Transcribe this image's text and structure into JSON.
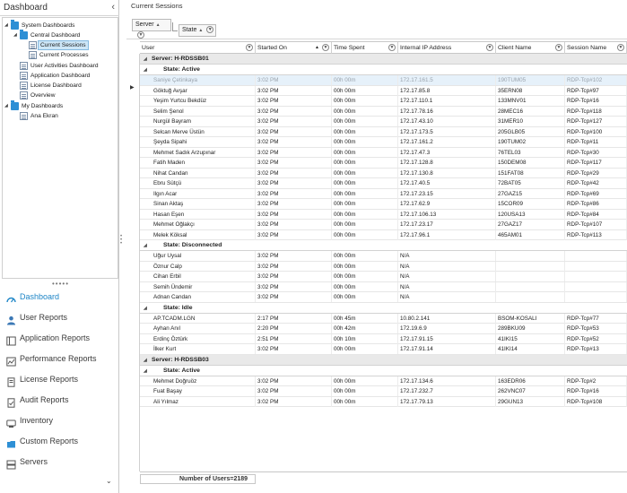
{
  "left": {
    "title": "Dashboard",
    "tree": [
      {
        "label": "System Dashboards",
        "icon": "folder-icon",
        "level": 0,
        "expanded": true
      },
      {
        "label": "Central Dashboard",
        "icon": "folder-icon",
        "level": 1,
        "expanded": true
      },
      {
        "label": "Current Sessions",
        "icon": "document-icon",
        "level": 2,
        "selected": true
      },
      {
        "label": "Current Processes",
        "icon": "document-icon",
        "level": 2
      },
      {
        "label": "User Activities Dashboard",
        "icon": "document-icon",
        "level": 1
      },
      {
        "label": "Application Dashboard",
        "icon": "document-icon",
        "level": 1
      },
      {
        "label": "License Dashboard",
        "icon": "document-icon",
        "level": 1
      },
      {
        "label": "Overview",
        "icon": "document-icon",
        "level": 1
      },
      {
        "label": "My Dashboards",
        "icon": "folder-icon",
        "level": 0,
        "expanded": true
      },
      {
        "label": "Ana Ekran",
        "icon": "document-icon",
        "level": 1
      }
    ],
    "nav": [
      {
        "label": "Dashboard",
        "icon": "dashboard-icon",
        "active": true
      },
      {
        "label": "User Reports",
        "icon": "user-icon"
      },
      {
        "label": "Application Reports",
        "icon": "application-icon"
      },
      {
        "label": "Performance Reports",
        "icon": "performance-icon"
      },
      {
        "label": "License Reports",
        "icon": "license-icon"
      },
      {
        "label": "Audit Reports",
        "icon": "audit-icon"
      },
      {
        "label": "Inventory",
        "icon": "inventory-icon"
      },
      {
        "label": "Custom Reports",
        "icon": "custom-reports-icon"
      },
      {
        "label": "Servers",
        "icon": "servers-icon"
      }
    ]
  },
  "main": {
    "title": "Current Sessions",
    "group_by": [
      "Server",
      "State"
    ],
    "columns": [
      "User",
      "Started On",
      "Time Spent",
      "Internal IP Address",
      "Client Name",
      "Session Name"
    ],
    "rows": [
      {
        "type": "server",
        "label": "Server: H-RDSSB01"
      },
      {
        "type": "state",
        "label": "State: Active"
      },
      {
        "type": "data",
        "dim": true,
        "current": true,
        "cells": [
          "Saniye Çetinkaya",
          "3:02 PM",
          "00h 00m",
          "172.17.161.5",
          "190TUM05",
          "RDP-Tcp#102"
        ]
      },
      {
        "type": "data",
        "cells": [
          "Göktuğ Avşar",
          "3:02 PM",
          "00h 00m",
          "172.17.85.8",
          "35ERN08",
          "RDP-Tcp#97"
        ]
      },
      {
        "type": "data",
        "cells": [
          "Yeşim Yurtcu Bekdüz",
          "3:02 PM",
          "00h 00m",
          "172.17.110.1",
          "133MNV01",
          "RDP-Tcp#16"
        ]
      },
      {
        "type": "data",
        "cells": [
          "Selim Şenol",
          "3:02 PM",
          "00h 00m",
          "172.17.78.16",
          "28MEC16",
          "RDP-Tcp#118"
        ]
      },
      {
        "type": "data",
        "cells": [
          "Nurgül Bayram",
          "3:02 PM",
          "00h 00m",
          "172.17.43.10",
          "31MER10",
          "RDP-Tcp#127"
        ]
      },
      {
        "type": "data",
        "cells": [
          "Selcan Merve Üstün",
          "3:02 PM",
          "00h 00m",
          "172.17.173.5",
          "205GLB05",
          "RDP-Tcp#100"
        ]
      },
      {
        "type": "data",
        "cells": [
          "Şeyda Sipahi",
          "3:02 PM",
          "00h 00m",
          "172.17.161.2",
          "190TUM02",
          "RDP-Tcp#11"
        ]
      },
      {
        "type": "data",
        "cells": [
          "Mehmet Sadık Arzupınar",
          "3:02 PM",
          "00h 00m",
          "172.17.47.3",
          "76TEL03",
          "RDP-Tcp#30"
        ]
      },
      {
        "type": "data",
        "cells": [
          "Fatih Maden",
          "3:02 PM",
          "00h 00m",
          "172.17.128.8",
          "150DEM08",
          "RDP-Tcp#117"
        ]
      },
      {
        "type": "data",
        "cells": [
          "Nihat Candan",
          "3:02 PM",
          "00h 00m",
          "172.17.130.8",
          "151FAT08",
          "RDP-Tcp#29"
        ]
      },
      {
        "type": "data",
        "cells": [
          "Ebru Sütçü",
          "3:02 PM",
          "00h 00m",
          "172.17.40.5",
          "72BAT05",
          "RDP-Tcp#42"
        ]
      },
      {
        "type": "data",
        "cells": [
          "Ilgın Acar",
          "3:02 PM",
          "00h 00m",
          "172.17.23.15",
          "27GAZ15",
          "RDP-Tcp#69"
        ]
      },
      {
        "type": "data",
        "cells": [
          "Sinan Aktaş",
          "3:02 PM",
          "00h 00m",
          "172.17.62.9",
          "15COR09",
          "RDP-Tcp#86"
        ]
      },
      {
        "type": "data",
        "cells": [
          "Hasan Eşen",
          "3:02 PM",
          "00h 00m",
          "172.17.106.13",
          "120USA13",
          "RDP-Tcp#84"
        ]
      },
      {
        "type": "data",
        "cells": [
          "Mehmet Oğlakçı",
          "3:02 PM",
          "00h 00m",
          "172.17.23.17",
          "27GAZ17",
          "RDP-Tcp#107"
        ]
      },
      {
        "type": "data",
        "cells": [
          "Melek Köksal",
          "3:02 PM",
          "00h 00m",
          "172.17.96.1",
          "465AM01",
          "RDP-Tcp#113"
        ]
      },
      {
        "type": "state",
        "label": "State: Disconnected"
      },
      {
        "type": "data",
        "cells": [
          "Uğur Uysal",
          "3:02 PM",
          "00h 00m",
          "N/A",
          "",
          ""
        ]
      },
      {
        "type": "data",
        "cells": [
          "Öznur Calp",
          "3:02 PM",
          "00h 00m",
          "N/A",
          "",
          ""
        ]
      },
      {
        "type": "data",
        "cells": [
          "Cihan Erbil",
          "3:02 PM",
          "00h 00m",
          "N/A",
          "",
          ""
        ]
      },
      {
        "type": "data",
        "cells": [
          "Semih Ündemir",
          "3:02 PM",
          "00h 00m",
          "N/A",
          "",
          ""
        ]
      },
      {
        "type": "data",
        "cells": [
          "Adnan Candan",
          "3:02 PM",
          "00h 00m",
          "N/A",
          "",
          ""
        ]
      },
      {
        "type": "state",
        "label": "State: Idle"
      },
      {
        "type": "data",
        "cells": [
          "AP.TCADM.LGN",
          "2:17 PM",
          "00h 45m",
          "10.80.2.141",
          "BSOM-KOSALI",
          "RDP-Tcp#77"
        ]
      },
      {
        "type": "data",
        "cells": [
          "Ayhan Anıl",
          "2:20 PM",
          "00h 42m",
          "172.19.6.9",
          "289BKU09",
          "RDP-Tcp#53"
        ]
      },
      {
        "type": "data",
        "cells": [
          "Erdinç Öztürk",
          "2:51 PM",
          "00h 10m",
          "172.17.91.15",
          "41IKI15",
          "RDP-Tcp#52"
        ]
      },
      {
        "type": "data",
        "cells": [
          "İlker Kurt",
          "3:02 PM",
          "00h 00m",
          "172.17.91.14",
          "41IKI14",
          "RDP-Tcp#13"
        ]
      },
      {
        "type": "server",
        "label": "Server: H-RDSSB03"
      },
      {
        "type": "state",
        "label": "State: Active"
      },
      {
        "type": "data",
        "cells": [
          "Mehmet Doğruöz",
          "3:02 PM",
          "00h 00m",
          "172.17.134.6",
          "163EDR06",
          "RDP-Tcp#2"
        ]
      },
      {
        "type": "data",
        "cells": [
          "Fuat Başay",
          "3:02 PM",
          "00h 00m",
          "172.17.232.7",
          "262VNC07",
          "RDP-Tcp#16"
        ]
      },
      {
        "type": "data",
        "cells": [
          "Ali Yılmaz",
          "3:02 PM",
          "00h 00m",
          "172.17.79.13",
          "29GUN13",
          "RDP-Tcp#108"
        ]
      }
    ],
    "footer": "Number of Users=2189"
  }
}
